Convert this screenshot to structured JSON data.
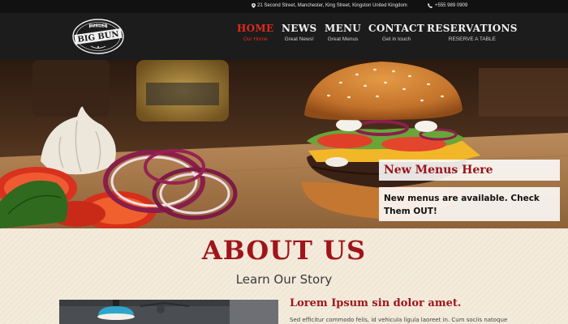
{
  "topbar": {
    "address": "21 Second Street, Manchester, King Street, Kingston United Kingdom",
    "phone": "+555 989 0909",
    "address_icon": "map-pin-icon",
    "phone_icon": "phone-icon"
  },
  "logo": {
    "top_text": "BURGER",
    "main_text": "BIG BUN"
  },
  "nav": {
    "items": [
      {
        "title": "HOME",
        "sub": "Our Home"
      },
      {
        "title": "NEWS",
        "sub": "Great News!"
      },
      {
        "title": "MENU",
        "sub": "Great Menus"
      },
      {
        "title": "CONTACT",
        "sub": "Get in touch"
      },
      {
        "title": "RESERVATIONS",
        "sub": "RESERVE A TABLE"
      }
    ]
  },
  "hero": {
    "banner_title": "New Menus Here",
    "banner_text": "New menus are available. Check Them OUT!"
  },
  "about": {
    "title": "ABOUT US",
    "subtitle": "Learn Our Story",
    "heading": "Lorem Ipsum sin dolor amet.",
    "text": "Sed efficitur commodo felis, id vehicula ligula laoreet in. Cum sociis natoque"
  },
  "colors": {
    "accent_red": "#a0141b",
    "nav_active": "#e02a1e",
    "header_bg": "#1c1c1c",
    "topbar_bg": "#111111",
    "section_bg": "#f4ebdb"
  }
}
